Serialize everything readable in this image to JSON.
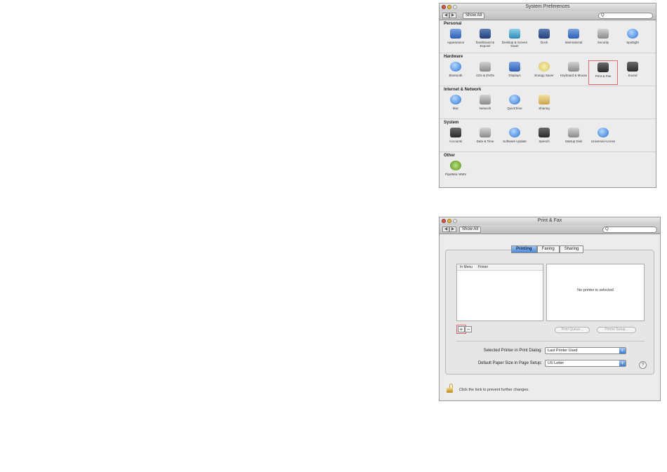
{
  "system_preferences": {
    "title": "System Preferences",
    "nav": {
      "back": "◀",
      "forward": "▶"
    },
    "show_all": "Show All",
    "search_value": "Q",
    "sections": [
      {
        "title": "Personal",
        "panes": [
          {
            "label": "Appearance",
            "icon": "appearance-icon",
            "color": "c-blue"
          },
          {
            "label": "Dashboard & Exposé",
            "icon": "dashboard-icon",
            "color": "c-navy"
          },
          {
            "label": "Desktop & Screen Saver",
            "icon": "desktop-icon",
            "color": "c-teal"
          },
          {
            "label": "Dock",
            "icon": "dock-icon",
            "color": "c-navy"
          },
          {
            "label": "International",
            "icon": "international-icon",
            "color": "c-blue"
          },
          {
            "label": "Security",
            "icon": "security-icon",
            "color": "c-gray"
          },
          {
            "label": "Spotlight",
            "icon": "spotlight-icon",
            "color": "c-orb"
          }
        ]
      },
      {
        "title": "Hardware",
        "panes": [
          {
            "label": "Bluetooth",
            "icon": "bluetooth-icon",
            "color": "c-orb"
          },
          {
            "label": "CDs & DVDs",
            "icon": "cd-icon",
            "color": "c-gray"
          },
          {
            "label": "Displays",
            "icon": "displays-icon",
            "color": "c-blue"
          },
          {
            "label": "Energy Saver",
            "icon": "energy-saver-icon",
            "color": "c-yellow"
          },
          {
            "label": "Keyboard & Mouse",
            "icon": "keyboard-icon",
            "color": "c-gray"
          },
          {
            "label": "Print & Fax",
            "icon": "printer-icon",
            "color": "c-dark",
            "highlight": true
          },
          {
            "label": "Sound",
            "icon": "sound-icon",
            "color": "c-dark"
          }
        ]
      },
      {
        "title": "Internet & Network",
        "panes": [
          {
            "label": "Mac",
            "icon": "mac-icon",
            "color": "c-orb"
          },
          {
            "label": "Network",
            "icon": "network-icon",
            "color": "c-gray"
          },
          {
            "label": "QuickTime",
            "icon": "quicktime-icon",
            "color": "c-orb"
          },
          {
            "label": "Sharing",
            "icon": "sharing-icon",
            "color": "c-folder"
          }
        ]
      },
      {
        "title": "System",
        "panes": [
          {
            "label": "Accounts",
            "icon": "accounts-icon",
            "color": "c-dark"
          },
          {
            "label": "Date & Time",
            "icon": "date-time-icon",
            "color": "c-gray"
          },
          {
            "label": "Software Update",
            "icon": "software-update-icon",
            "color": "c-orb"
          },
          {
            "label": "Speech",
            "icon": "speech-icon",
            "color": "c-dark"
          },
          {
            "label": "Startup Disk",
            "icon": "startup-disk-icon",
            "color": "c-gray"
          },
          {
            "label": "Universal Access",
            "icon": "universal-access-icon",
            "color": "c-orb"
          }
        ]
      },
      {
        "title": "Other",
        "panes": [
          {
            "label": "Flip4Mac WMV",
            "icon": "flip4mac-icon",
            "color": "c-green"
          }
        ]
      }
    ]
  },
  "print_fax": {
    "title": "Print & Fax",
    "nav": {
      "back": "◀",
      "forward": "▶"
    },
    "show_all": "Show All",
    "search_value": "Q",
    "tabs": [
      "Printing",
      "Faxing",
      "Sharing"
    ],
    "active_tab": "Printing",
    "list_headers": [
      "In Menu",
      "Printer"
    ],
    "no_printer_text": "No printer is selected",
    "add_button": "+",
    "remove_button": "−",
    "print_queue_button": "Print Queue...",
    "printer_setup_button": "Printer Setup...",
    "selected_printer_label": "Selected Printer in Print Dialog:",
    "selected_printer_value": "Last Printer Used",
    "paper_size_label": "Default Paper Size in Page Setup:",
    "paper_size_value": "US Letter",
    "help_button": "?",
    "lock_text": "Click the lock to prevent further changes."
  }
}
